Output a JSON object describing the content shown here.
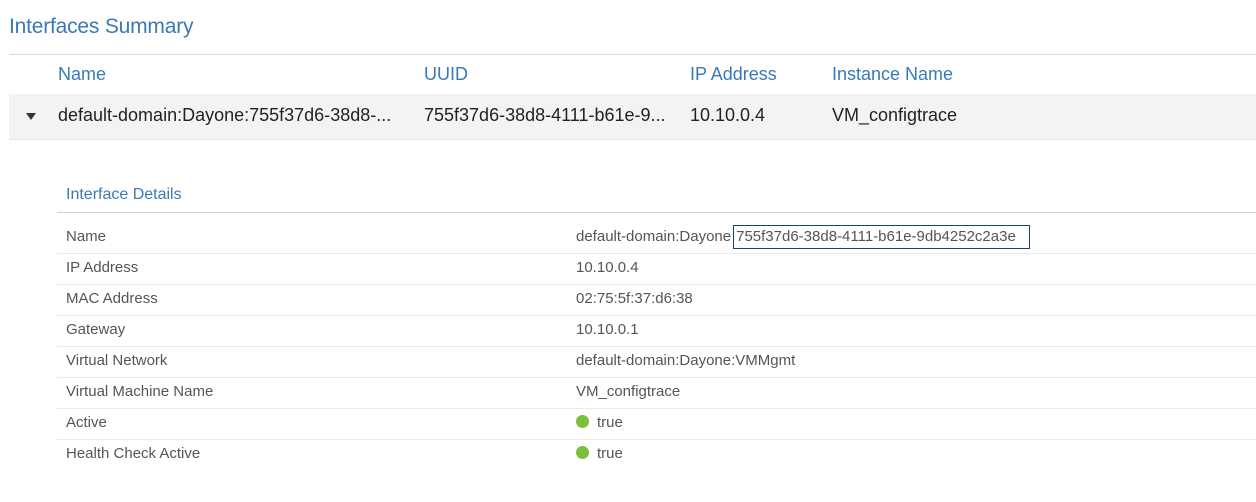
{
  "page": {
    "title": "Interfaces Summary"
  },
  "grid": {
    "columns": {
      "name": "Name",
      "uuid": "UUID",
      "ip": "IP Address",
      "instance": "Instance Name"
    },
    "rows": [
      {
        "name": "default-domain:Dayone:755f37d6-38d8-...",
        "uuid": "755f37d6-38d8-4111-b61e-9...",
        "ip": "10.10.0.4",
        "instance": "VM_configtrace",
        "expanded": true
      }
    ]
  },
  "details": {
    "title": "Interface Details",
    "rows": [
      {
        "label": "Name",
        "value_prefix": "default-domain:Dayone",
        "value_highlight": "755f37d6-38d8-4111-b61e-9db4252c2a3e"
      },
      {
        "label": "IP Address",
        "value": "10.10.0.4"
      },
      {
        "label": "MAC Address",
        "value": "02:75:5f:37:d6:38"
      },
      {
        "label": "Gateway",
        "value": "10.10.0.1"
      },
      {
        "label": "Virtual Network",
        "value": "default-domain:Dayone:VMMgmt"
      },
      {
        "label": "Virtual Machine Name",
        "value": "VM_configtrace"
      },
      {
        "label": "Active",
        "value": "true",
        "status_color": "#7bbf3d"
      },
      {
        "label": "Health Check Active",
        "value": "true",
        "status_color": "#7bbf3d"
      }
    ]
  },
  "colors": {
    "accent": "#3b78b8",
    "highlight_border": "#1e3f73",
    "status_ok": "#7bbf3d"
  }
}
